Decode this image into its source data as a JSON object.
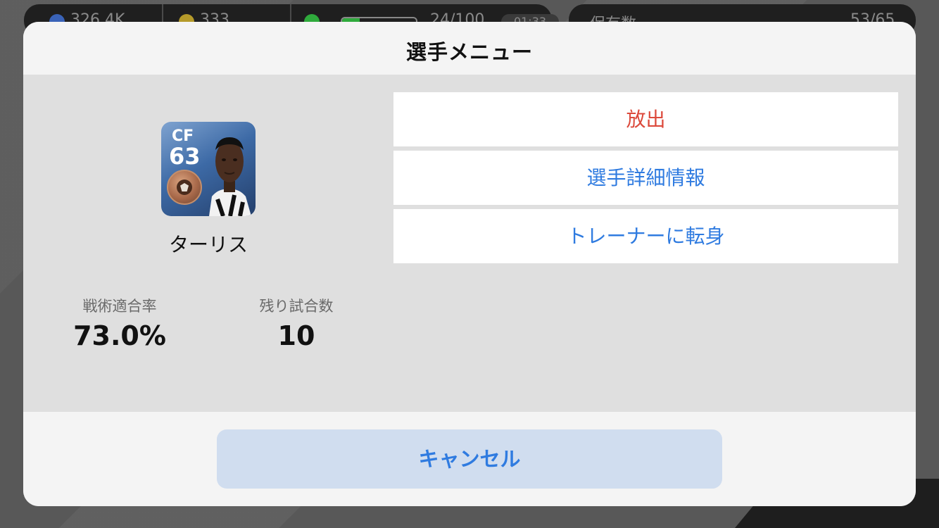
{
  "background": {
    "top_left": {
      "currency1": "326.4K",
      "currency2": "333",
      "stamina": "24/100",
      "timer": "01:33"
    },
    "top_right": {
      "label": "保有数",
      "value": "53/65"
    }
  },
  "modal": {
    "title": "選手メニュー",
    "player": {
      "position": "CF",
      "rating": "63",
      "name": "ターリス",
      "medal_icon": "bronze-medal-icon"
    },
    "stats": {
      "tactic_label": "戦術適合率",
      "tactic_value": "73.0%",
      "remaining_label": "残り試合数",
      "remaining_value": "10"
    },
    "menu": {
      "release": "放出",
      "details": "選手詳細情報",
      "trainer": "トレーナーに転身"
    },
    "cancel": "キャンセル"
  },
  "colors": {
    "danger": "#dc4a3c",
    "link": "#2f7be0",
    "cancel_bg": "#d0ddef"
  }
}
